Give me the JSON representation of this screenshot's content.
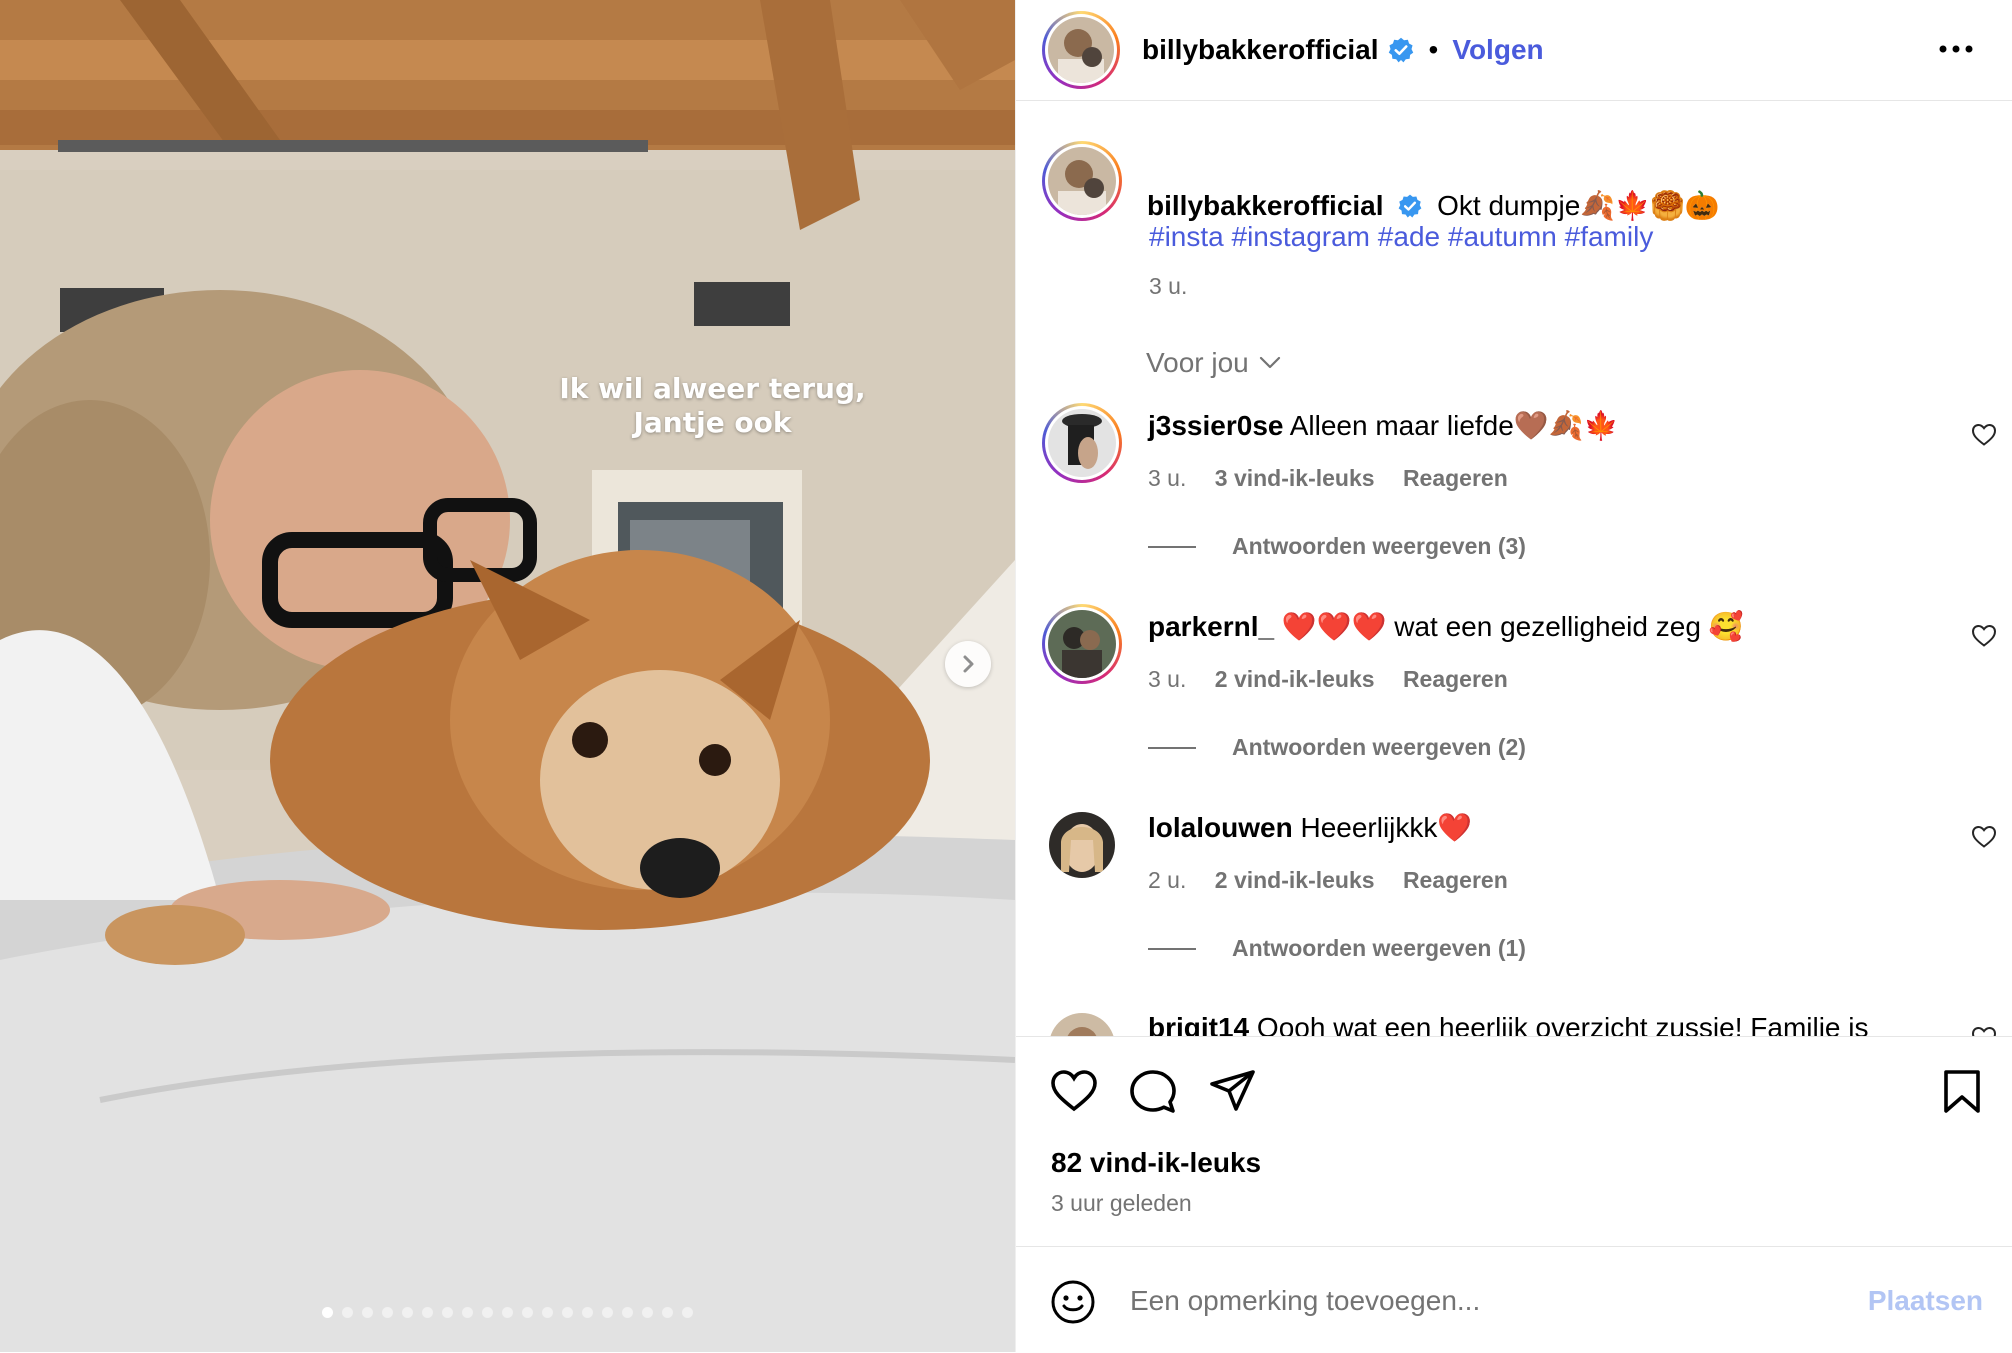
{
  "story": {
    "overlay_lines": [
      "Ik wil alweer terug,",
      "Jantje ook"
    ],
    "slides_total": 19,
    "active_slide": 1
  },
  "header": {
    "username": "billybakkerofficial",
    "separator": "•",
    "follow_label": "Volgen"
  },
  "caption": {
    "username": "billybakkerofficial",
    "text": "Okt dumpje🍂🍁🥮🎃",
    "hashtags": [
      "#insta",
      "#instagram",
      "#ade",
      "#autumn",
      "#family"
    ],
    "time": "3 u."
  },
  "filter": {
    "label": "Voor jou"
  },
  "comments": [
    {
      "username": "j3ssier0se",
      "text": "Alleen maar liefde🤎🍂🍁",
      "time": "3 u.",
      "likes": "3 vind-ik-leuks",
      "reply_label": "Reageren",
      "view_replies": "Antwoorden weergeven (3)"
    },
    {
      "username": "parkernl_",
      "text": "❤️❤️❤️ wat een gezelligheid zeg 🥰",
      "time": "3 u.",
      "likes": "2 vind-ik-leuks",
      "reply_label": "Reageren",
      "view_replies": "Antwoorden weergeven (2)"
    },
    {
      "username": "lolalouwen",
      "text": "Heeerlijkkk❤️",
      "time": "2 u.",
      "likes": "2 vind-ik-leuks",
      "reply_label": "Reageren",
      "view_replies": "Antwoorden weergeven (1)"
    },
    {
      "username": "brigit14",
      "text": "Oooh wat een heerlijk overzicht zussie! Familie is"
    }
  ],
  "footer": {
    "likes": "82 vind-ik-leuks",
    "time_ago": "3 uur geleden",
    "comment_placeholder": "Een opmerking toevoegen...",
    "post_label": "Plaatsen"
  },
  "colors": {
    "accent": "#4a5bdc",
    "muted": "#737373",
    "verified": "#3897f0",
    "post_disabled": "#b2c5f4"
  }
}
